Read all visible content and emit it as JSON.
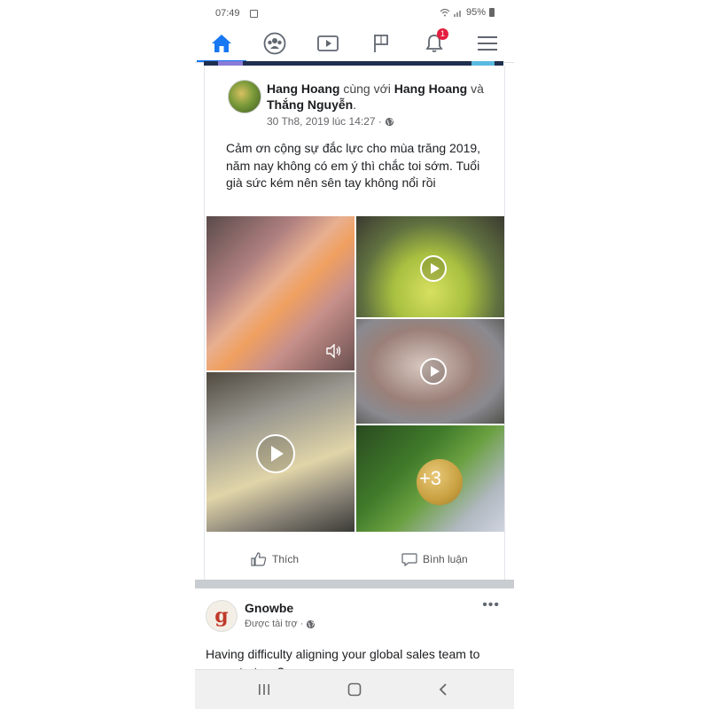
{
  "status_bar": {
    "time": "07:49",
    "battery": "95%"
  },
  "nav": {
    "items": [
      {
        "name": "home",
        "active": true
      },
      {
        "name": "groups"
      },
      {
        "name": "watch"
      },
      {
        "name": "pages"
      },
      {
        "name": "notifications",
        "badge": "1"
      },
      {
        "name": "menu"
      }
    ],
    "accent": "#1877f2"
  },
  "post": {
    "author": "Hang Hoang",
    "with_word": "cùng với",
    "tagged_1": "Hang Hoang",
    "and_word": "và",
    "tagged_2": "Thắng Nguyễn",
    "date": "30 Th8, 2019 lúc 14:27 ·",
    "privacy_icon": "globe-icon",
    "text": "Cảm ơn cộng sự đắc lực cho mùa trăng 2019, năm nay không có em ý thì chắc toi sớm. Tuổi già sức kém nên sên tay không nổi rồi",
    "more_count": "+3",
    "actions": {
      "like": "Thích",
      "comment": "Bình luận"
    }
  },
  "post2": {
    "author": "Gnowbe",
    "avatar_letter": "g",
    "sponsored": "Được tài trợ ·",
    "text": "Having difficulty aligning your global sales team to your strategy?"
  }
}
